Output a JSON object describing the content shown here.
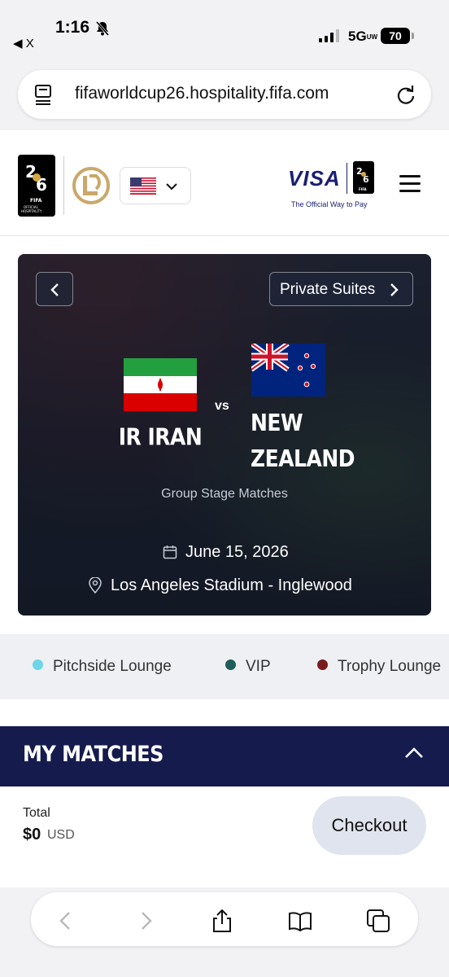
{
  "status_bar": {
    "time": "1:16",
    "back_app": "◀ X",
    "network": "5G",
    "network_sub": "UW",
    "battery": "70"
  },
  "browser": {
    "url": "fifaworldcup26.hospitality.fifa.com"
  },
  "header": {
    "visa_logo": "VISA",
    "visa_tagline": "The Official Way to Pay",
    "fifa_logo_text": "FIFA OFFICIAL HOSPITALITY",
    "country_flag": "us-flag"
  },
  "hero": {
    "suite_button": "Private Suites",
    "home_team": "IR IRAN",
    "away_team_line1": "NEW",
    "away_team_line2": "ZEALAND",
    "vs": "vs",
    "stage": "Group Stage Matches",
    "date": "June 15, 2026",
    "venue": "Los Angeles Stadium - Inglewood"
  },
  "legend": {
    "items": [
      {
        "label": "Pitchside Lounge",
        "color": "#6dd6e8"
      },
      {
        "label": "VIP",
        "color": "#1f5d5a"
      },
      {
        "label": "Trophy Lounge",
        "color": "#7a1c1c"
      }
    ]
  },
  "my_matches": {
    "title": "MY MATCHES",
    "total_label": "Total",
    "total_value": "$0",
    "currency": "USD",
    "checkout": "Checkout"
  },
  "colors": {
    "navy": "#151b4d",
    "visa_blue": "#1a1f71"
  }
}
